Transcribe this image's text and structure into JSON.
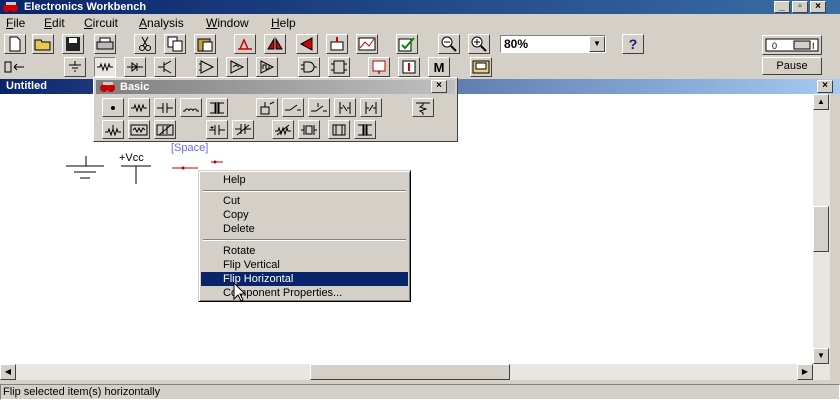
{
  "window": {
    "title": "Electronics Workbench"
  },
  "menubar": {
    "items": [
      {
        "label": "File",
        "u": "F",
        "rest": "ile"
      },
      {
        "label": "Edit",
        "u": "E",
        "rest": "dit"
      },
      {
        "label": "Circuit",
        "u": "C",
        "rest": "ircuit"
      },
      {
        "label": "Analysis",
        "u": "A",
        "rest": "nalysis"
      },
      {
        "label": "Window",
        "u": "W",
        "rest": "indow"
      },
      {
        "label": "Help",
        "u": "H",
        "rest": "elp"
      }
    ]
  },
  "toolbar": {
    "zoom_value": "80%",
    "pause_label": "Pause"
  },
  "document": {
    "title": "Untitled"
  },
  "parts_bin": {
    "title": "Basic"
  },
  "canvas": {
    "vcc_label": "+Vcc",
    "space_label": "[Space]"
  },
  "context_menu": {
    "help": "Help",
    "cut": "Cut",
    "copy": "Copy",
    "delete": "Delete",
    "rotate": "Rotate",
    "flip_vertical": "Flip Vertical",
    "flip_horizontal": "Flip Horizontal",
    "component_properties": "Component Properties..."
  },
  "statusbar": {
    "text": "Flip selected item(s) horizontally"
  },
  "colors": {
    "title_active": "#0a246a",
    "highlight": "#0a246a",
    "space_label": "#6a6af0",
    "wire_red": "#c00000"
  },
  "icons": [
    "app-icon",
    "new-icon",
    "open-icon",
    "save-icon",
    "print-icon",
    "cut-icon",
    "copy-icon",
    "paste-icon",
    "rotate-icon",
    "flip-horizontal-icon",
    "flip-vertical-icon",
    "subcircuit-icon",
    "graph-icon",
    "component-properties-icon",
    "zoom-out-icon",
    "zoom-in-icon",
    "help-icon",
    "power-switch-icon"
  ]
}
